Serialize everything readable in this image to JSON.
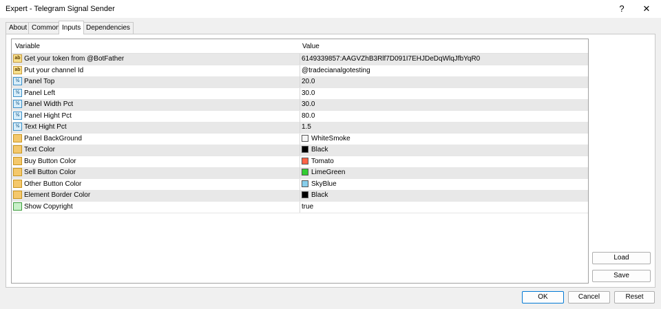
{
  "window": {
    "title": "Expert - Telegram Signal Sender",
    "help_label": "?",
    "close_label": "✕"
  },
  "tabs": [
    {
      "label": "About"
    },
    {
      "label": "Common"
    },
    {
      "label": "Inputs"
    },
    {
      "label": "Dependencies"
    }
  ],
  "table": {
    "headers": {
      "variable": "Variable",
      "value": "Value"
    },
    "rows": [
      {
        "type": "string",
        "icon": "ab",
        "name": "Get your token from @BotFather",
        "value": "6149339857:AAGVZhB3Rlf7D091I7EHJDeDqWlqJfbYqR0"
      },
      {
        "type": "string",
        "icon": "ab",
        "name": "Put your channel Id",
        "value": "@tradecianalgotesting"
      },
      {
        "type": "number",
        "icon": "½",
        "name": "Panel Top",
        "value": "20.0"
      },
      {
        "type": "number",
        "icon": "½",
        "name": "Panel Left",
        "value": "30.0"
      },
      {
        "type": "number",
        "icon": "½",
        "name": "Panel Width Pct",
        "value": "30.0"
      },
      {
        "type": "number",
        "icon": "½",
        "name": "Panel Hight Pct",
        "value": "80.0"
      },
      {
        "type": "number",
        "icon": "½",
        "name": "Text Hight Pct",
        "value": "1.5"
      },
      {
        "type": "color",
        "icon": "",
        "name": "Panel BackGround",
        "value": "WhiteSmoke",
        "swatch": "#f5f5f5"
      },
      {
        "type": "color",
        "icon": "",
        "name": "Text Color",
        "value": "Black",
        "swatch": "#000000"
      },
      {
        "type": "color",
        "icon": "",
        "name": "Buy Button Color",
        "value": "Tomato",
        "swatch": "#ff6347"
      },
      {
        "type": "color",
        "icon": "",
        "name": "Sell Button Color",
        "value": "LimeGreen",
        "swatch": "#32cd32"
      },
      {
        "type": "color",
        "icon": "",
        "name": "Other Button Color",
        "value": "SkyBlue",
        "swatch": "#87ceeb"
      },
      {
        "type": "color",
        "icon": "",
        "name": "Element Border Color",
        "value": "Black",
        "swatch": "#000000"
      },
      {
        "type": "bool",
        "icon": "",
        "name": "Show Copyright",
        "value": "true"
      }
    ]
  },
  "buttons": {
    "load": "Load",
    "save": "Save",
    "ok": "OK",
    "cancel": "Cancel",
    "reset": "Reset"
  },
  "colors": {
    "accent": "#0078d4"
  }
}
